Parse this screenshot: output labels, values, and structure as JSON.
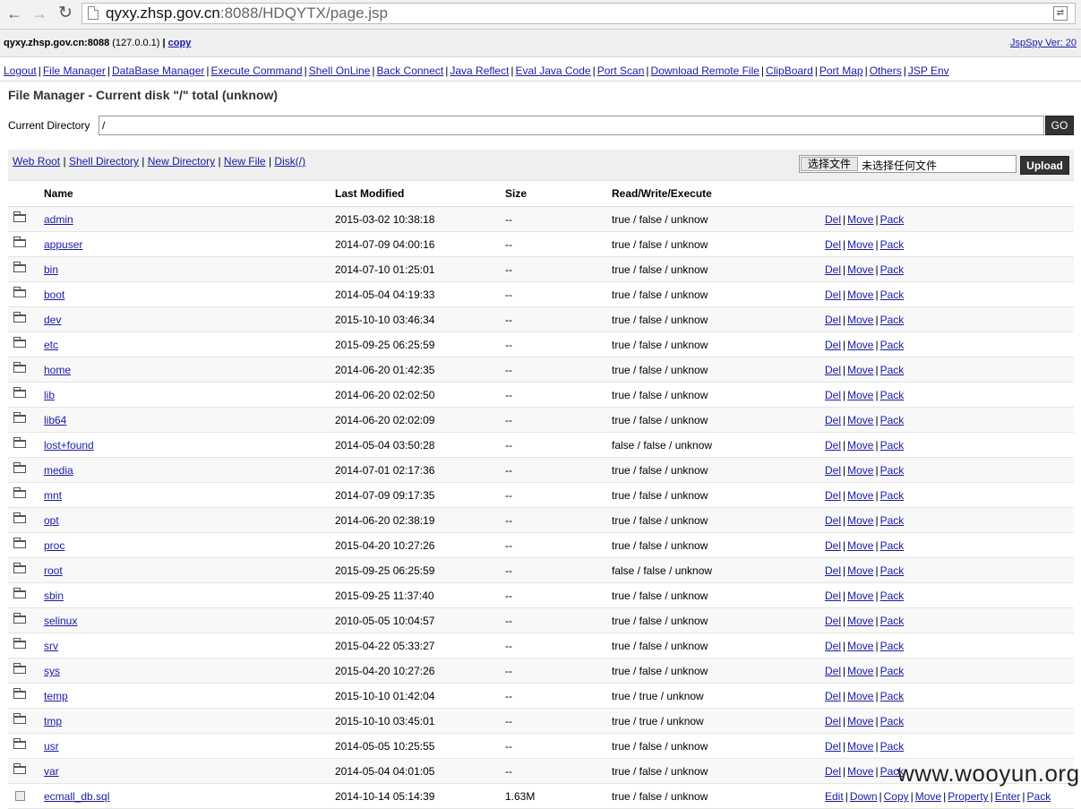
{
  "browser": {
    "url_host": "qyxy.zhsp.gov.cn",
    "url_rest": ":8088/HDQYTX/page.jsp"
  },
  "header": {
    "host": "qyxy.zhsp.gov.cn:8088",
    "ip": "(127.0.0.1)",
    "copy_label": "copy",
    "version": "JspSpy Ver: 20"
  },
  "menu": [
    "Logout",
    "File Manager",
    "DataBase Manager",
    "Execute Command",
    "Shell OnLine",
    "Back Connect",
    "Java Reflect",
    "Eval Java Code",
    "Port Scan",
    "Download Remote File",
    "ClipBoard",
    "Port Map",
    "Others",
    "JSP Env"
  ],
  "page_title": "File Manager - Current disk \"/\" total (unknow)",
  "current_directory": {
    "label": "Current Directory",
    "value": "/",
    "go_label": "GO"
  },
  "toolbar": {
    "links": [
      "Web Root",
      "Shell Directory",
      "New Directory",
      "New File",
      "Disk(/)"
    ],
    "file_button": "选择文件",
    "file_status": "未选择任何文件",
    "upload_label": "Upload"
  },
  "table": {
    "headers": {
      "name": "Name",
      "modified": "Last Modified",
      "size": "Size",
      "rwx": "Read/Write/Execute"
    },
    "dir_actions": [
      "Del",
      "Move",
      "Pack"
    ],
    "file_actions": [
      "Edit",
      "Down",
      "Copy",
      "Move",
      "Property",
      "Enter",
      "Pack"
    ],
    "rows": [
      {
        "name": "admin",
        "modified": "2015-03-02 10:38:18",
        "size": "--",
        "rwx": "true / false / unknow",
        "type": "dir"
      },
      {
        "name": "appuser",
        "modified": "2014-07-09 04:00:16",
        "size": "--",
        "rwx": "true / false / unknow",
        "type": "dir"
      },
      {
        "name": "bin",
        "modified": "2014-07-10 01:25:01",
        "size": "--",
        "rwx": "true / false / unknow",
        "type": "dir"
      },
      {
        "name": "boot",
        "modified": "2014-05-04 04:19:33",
        "size": "--",
        "rwx": "true / false / unknow",
        "type": "dir"
      },
      {
        "name": "dev",
        "modified": "2015-10-10 03:46:34",
        "size": "--",
        "rwx": "true / false / unknow",
        "type": "dir"
      },
      {
        "name": "etc",
        "modified": "2015-09-25 06:25:59",
        "size": "--",
        "rwx": "true / false / unknow",
        "type": "dir"
      },
      {
        "name": "home",
        "modified": "2014-06-20 01:42:35",
        "size": "--",
        "rwx": "true / false / unknow",
        "type": "dir"
      },
      {
        "name": "lib",
        "modified": "2014-06-20 02:02:50",
        "size": "--",
        "rwx": "true / false / unknow",
        "type": "dir"
      },
      {
        "name": "lib64",
        "modified": "2014-06-20 02:02:09",
        "size": "--",
        "rwx": "true / false / unknow",
        "type": "dir"
      },
      {
        "name": "lost+found",
        "modified": "2014-05-04 03:50:28",
        "size": "--",
        "rwx": "false / false / unknow",
        "type": "dir"
      },
      {
        "name": "media",
        "modified": "2014-07-01 02:17:36",
        "size": "--",
        "rwx": "true / false / unknow",
        "type": "dir"
      },
      {
        "name": "mnt",
        "modified": "2014-07-09 09:17:35",
        "size": "--",
        "rwx": "true / false / unknow",
        "type": "dir"
      },
      {
        "name": "opt",
        "modified": "2014-06-20 02:38:19",
        "size": "--",
        "rwx": "true / false / unknow",
        "type": "dir"
      },
      {
        "name": "proc",
        "modified": "2015-04-20 10:27:26",
        "size": "--",
        "rwx": "true / false / unknow",
        "type": "dir"
      },
      {
        "name": "root",
        "modified": "2015-09-25 06:25:59",
        "size": "--",
        "rwx": "false / false / unknow",
        "type": "dir"
      },
      {
        "name": "sbin",
        "modified": "2015-09-25 11:37:40",
        "size": "--",
        "rwx": "true / false / unknow",
        "type": "dir"
      },
      {
        "name": "selinux",
        "modified": "2010-05-05 10:04:57",
        "size": "--",
        "rwx": "true / false / unknow",
        "type": "dir"
      },
      {
        "name": "srv",
        "modified": "2015-04-22 05:33:27",
        "size": "--",
        "rwx": "true / false / unknow",
        "type": "dir"
      },
      {
        "name": "sys",
        "modified": "2015-04-20 10:27:26",
        "size": "--",
        "rwx": "true / false / unknow",
        "type": "dir"
      },
      {
        "name": "temp",
        "modified": "2015-10-10 01:42:04",
        "size": "--",
        "rwx": "true / true / unknow",
        "type": "dir"
      },
      {
        "name": "tmp",
        "modified": "2015-10-10 03:45:01",
        "size": "--",
        "rwx": "true / true / unknow",
        "type": "dir"
      },
      {
        "name": "usr",
        "modified": "2014-05-05 10:25:55",
        "size": "--",
        "rwx": "true / false / unknow",
        "type": "dir"
      },
      {
        "name": "var",
        "modified": "2014-05-04 04:01:05",
        "size": "--",
        "rwx": "true / false / unknow",
        "type": "dir"
      },
      {
        "name": "ecmall_db.sql",
        "modified": "2014-10-14 05:14:39",
        "size": "1.63M",
        "rwx": "true / false / unknow",
        "type": "file"
      }
    ]
  },
  "watermark": "www.wooyun.org"
}
